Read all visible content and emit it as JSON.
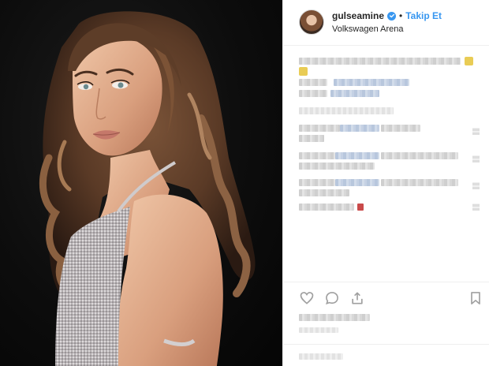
{
  "post": {
    "username": "gulseamine",
    "verified": true,
    "separator": "•",
    "follow_label": "Takip Et",
    "location": "Volkswagen Arena"
  },
  "icons": {
    "verified": "verified-badge-icon",
    "like": "heart-icon",
    "comment": "comment-icon",
    "share": "share-icon",
    "save": "bookmark-icon"
  },
  "colors": {
    "accent": "#3897f0",
    "text": "#262626",
    "border": "#efefef"
  }
}
